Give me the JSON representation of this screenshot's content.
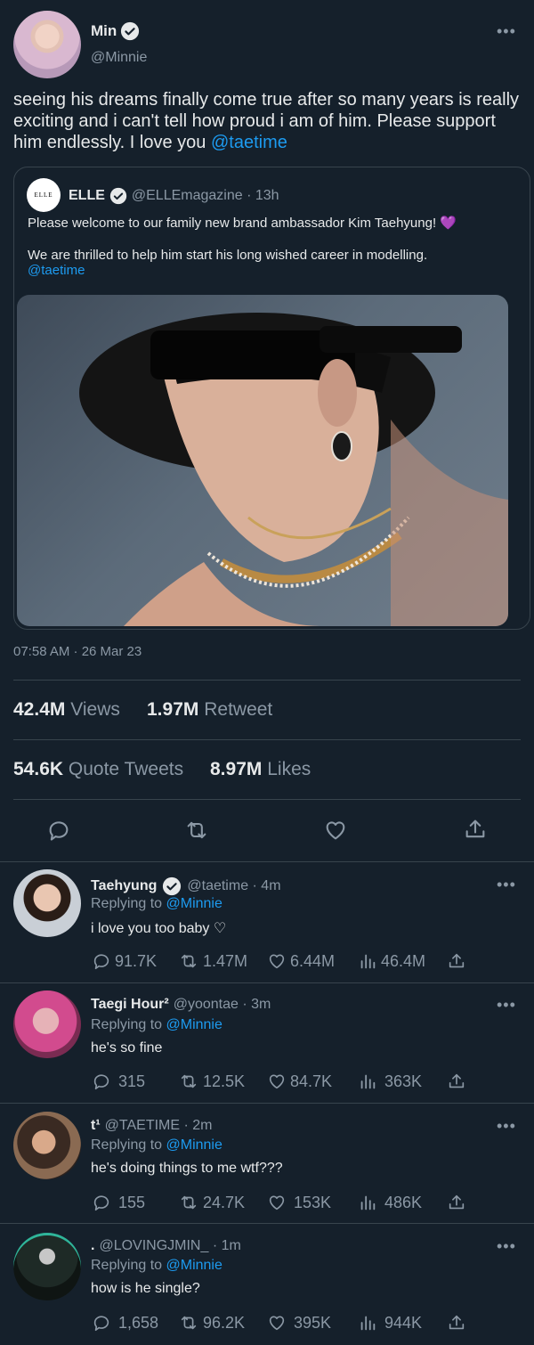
{
  "main_tweet": {
    "display_name": "Min",
    "handle": "@Minnie",
    "text": "seeing his dreams finally come true after so many years is really exciting and i can't tell how proud i am of him. Please support him endlessly. I love you",
    "mention": "@taetime",
    "timestamp": "07:58 AM · 26 Mar 23"
  },
  "quoted_tweet": {
    "avatar_text": "ELLE",
    "display_name": "ELLE",
    "handle_time": "@ELLEmagazine · 13h",
    "line1": "Please welcome to our family new brand ambassador Kim Taehyung! 💜",
    "line2": "We are thrilled to help him start his long wished career in modelling.",
    "mention": "@taetime"
  },
  "stats": {
    "views_value": "42.4M",
    "views_label": "Views",
    "retweets_value": "1.97M",
    "retweets_label": "Retweet",
    "quotes_value": "54.6K",
    "quotes_label": "Quote Tweets",
    "likes_value": "8.97M",
    "likes_label": "Likes"
  },
  "replies": [
    {
      "name": "Taehyung",
      "handle_time": "@taetime · 4m",
      "replying_label": "Replying to",
      "replying_to": "@Minnie",
      "text": "i love you too baby ♡",
      "comments": "91.7K",
      "retweets": "1.47M",
      "likes": "6.44M",
      "views": "46.4M"
    },
    {
      "name": "Taegi Hour²",
      "handle_time": "@yoontae · 3m",
      "replying_label": "Replying to",
      "replying_to": "@Minnie",
      "text": "he's so fine",
      "comments": "315",
      "retweets": "12.5K",
      "likes": "84.7K",
      "views": "363K"
    },
    {
      "name": "t¹",
      "handle_time": "@TAETIME · 2m",
      "replying_label": "Replying to",
      "replying_to": "@Minnie",
      "text": "he's doing things to me wtf???",
      "comments": "155",
      "retweets": "24.7K",
      "likes": "153K",
      "views": "486K"
    },
    {
      "name": ".",
      "handle_time": "@LOVINGJMIN_ · 1m",
      "replying_label": "Replying to",
      "replying_to": "@Minnie",
      "text": "how is he single?",
      "comments": "1,658",
      "retweets": "96.2K",
      "likes": "395K",
      "views": "944K"
    }
  ],
  "icons": {
    "verified": "verified-badge-icon",
    "more": "more-icon",
    "reply": "reply-icon",
    "retweet": "retweet-icon",
    "like": "heart-icon",
    "views": "views-icon",
    "share": "share-icon"
  },
  "colors": {
    "background": "#15202b",
    "accent": "#1d9bf0",
    "text": "#e7e9ea",
    "muted": "#8b98a5",
    "heart_emoji": "#a66bd6"
  }
}
